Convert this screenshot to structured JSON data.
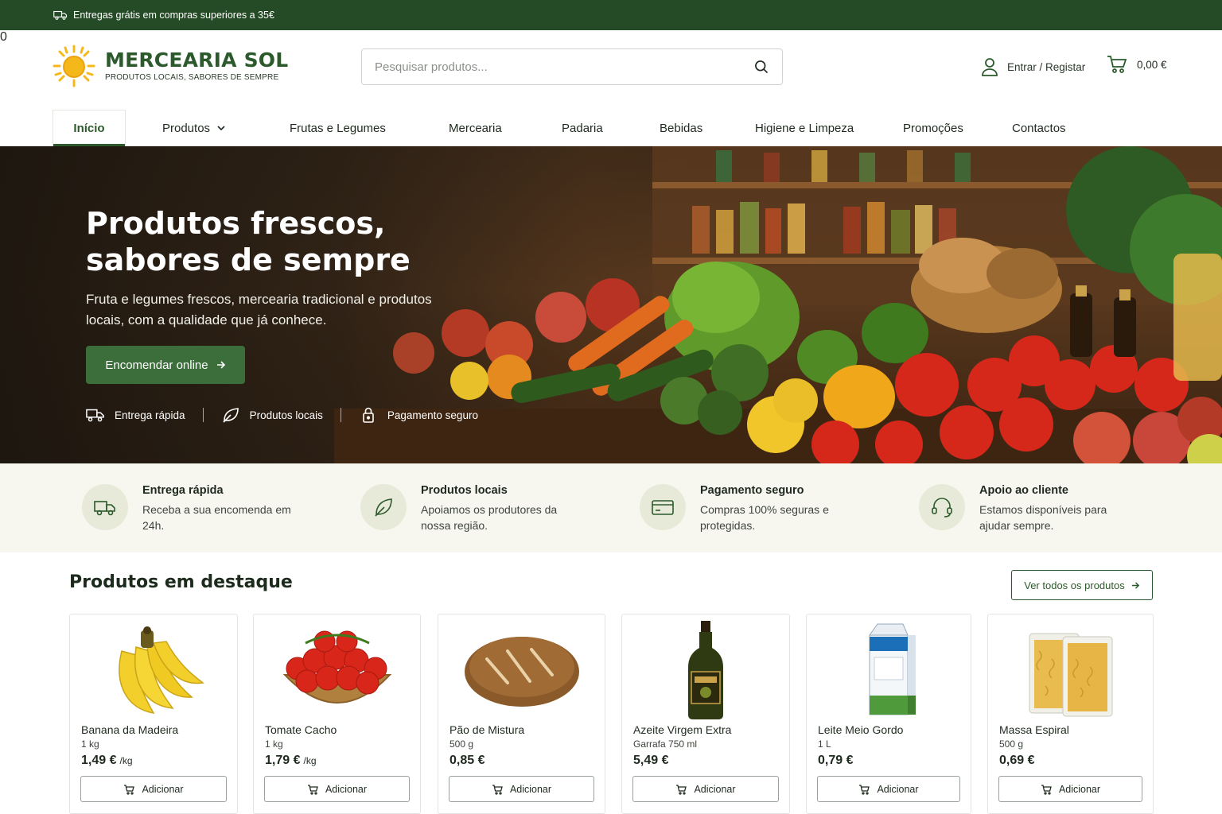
{
  "topbar": {
    "text": "Entregas grátis em compras superiores a 35€",
    "icon": "truck-icon"
  },
  "header": {
    "brand": "MERCEARIA SOL",
    "tagline": "PRODUTOS LOCAIS, SABORES DE SEMPRE",
    "search_placeholder": "Pesquisar produtos...",
    "account_label": "Entrar / Registar",
    "cart_count": "0",
    "cart_total": "0,00 €"
  },
  "nav": {
    "items": [
      "Início",
      "Produtos",
      "Frutas e Legumes",
      "Mercearia",
      "Padaria",
      "Bebidas",
      "Higiene e Limpeza",
      "Promoções",
      "Contactos"
    ],
    "active": "Início"
  },
  "hero": {
    "title": "Produtos frescos, sabores de sempre",
    "subtitle": "Fruta e legumes frescos, mercearia tradicional e produtos locais, com a qualidade que já conhece.",
    "cta": "Encomendar online",
    "features": [
      "Entrega rápida",
      "Produtos locais",
      "Pagamento seguro"
    ]
  },
  "benefits": [
    {
      "title": "Entrega rápida",
      "desc": "Receba a sua encomenda em 24h.",
      "icon": "truck-icon"
    },
    {
      "title": "Produtos locais",
      "desc": "Apoiamos os produtores da nossa região.",
      "icon": "leaf-icon"
    },
    {
      "title": "Pagamento seguro",
      "desc": "Compras 100% seguras e protegidas.",
      "icon": "credit-card-icon"
    },
    {
      "title": "Apoio ao cliente",
      "desc": "Estamos disponíveis para ajudar sempre.",
      "icon": "headset-icon"
    }
  ],
  "featured": {
    "title": "Produtos em destaque",
    "view_all": "Ver todos os produtos",
    "add_label": "Adicionar",
    "products": [
      {
        "name": "Banana da Madeira",
        "size": "1 kg",
        "price": "1,49 €",
        "unit": "/kg"
      },
      {
        "name": "Tomate Cacho",
        "size": "1 kg",
        "price": "1,79 €",
        "unit": "/kg"
      },
      {
        "name": "Pão de Mistura",
        "size": "500 g",
        "price": "0,85 €",
        "unit": ""
      },
      {
        "name": "Azeite Virgem Extra",
        "size": "Garrafa 750 ml",
        "price": "5,49 €",
        "unit": ""
      },
      {
        "name": "Leite Meio Gordo",
        "size": "1 L",
        "price": "0,79 €",
        "unit": ""
      },
      {
        "name": "Massa Espiral",
        "size": "500 g",
        "price": "0,69 €",
        "unit": ""
      }
    ]
  },
  "colors": {
    "brand_green": "#254a26",
    "accent_green": "#3b6e3a",
    "sun_yellow": "#f4b81a",
    "benefits_bg": "#f7f6ef"
  }
}
